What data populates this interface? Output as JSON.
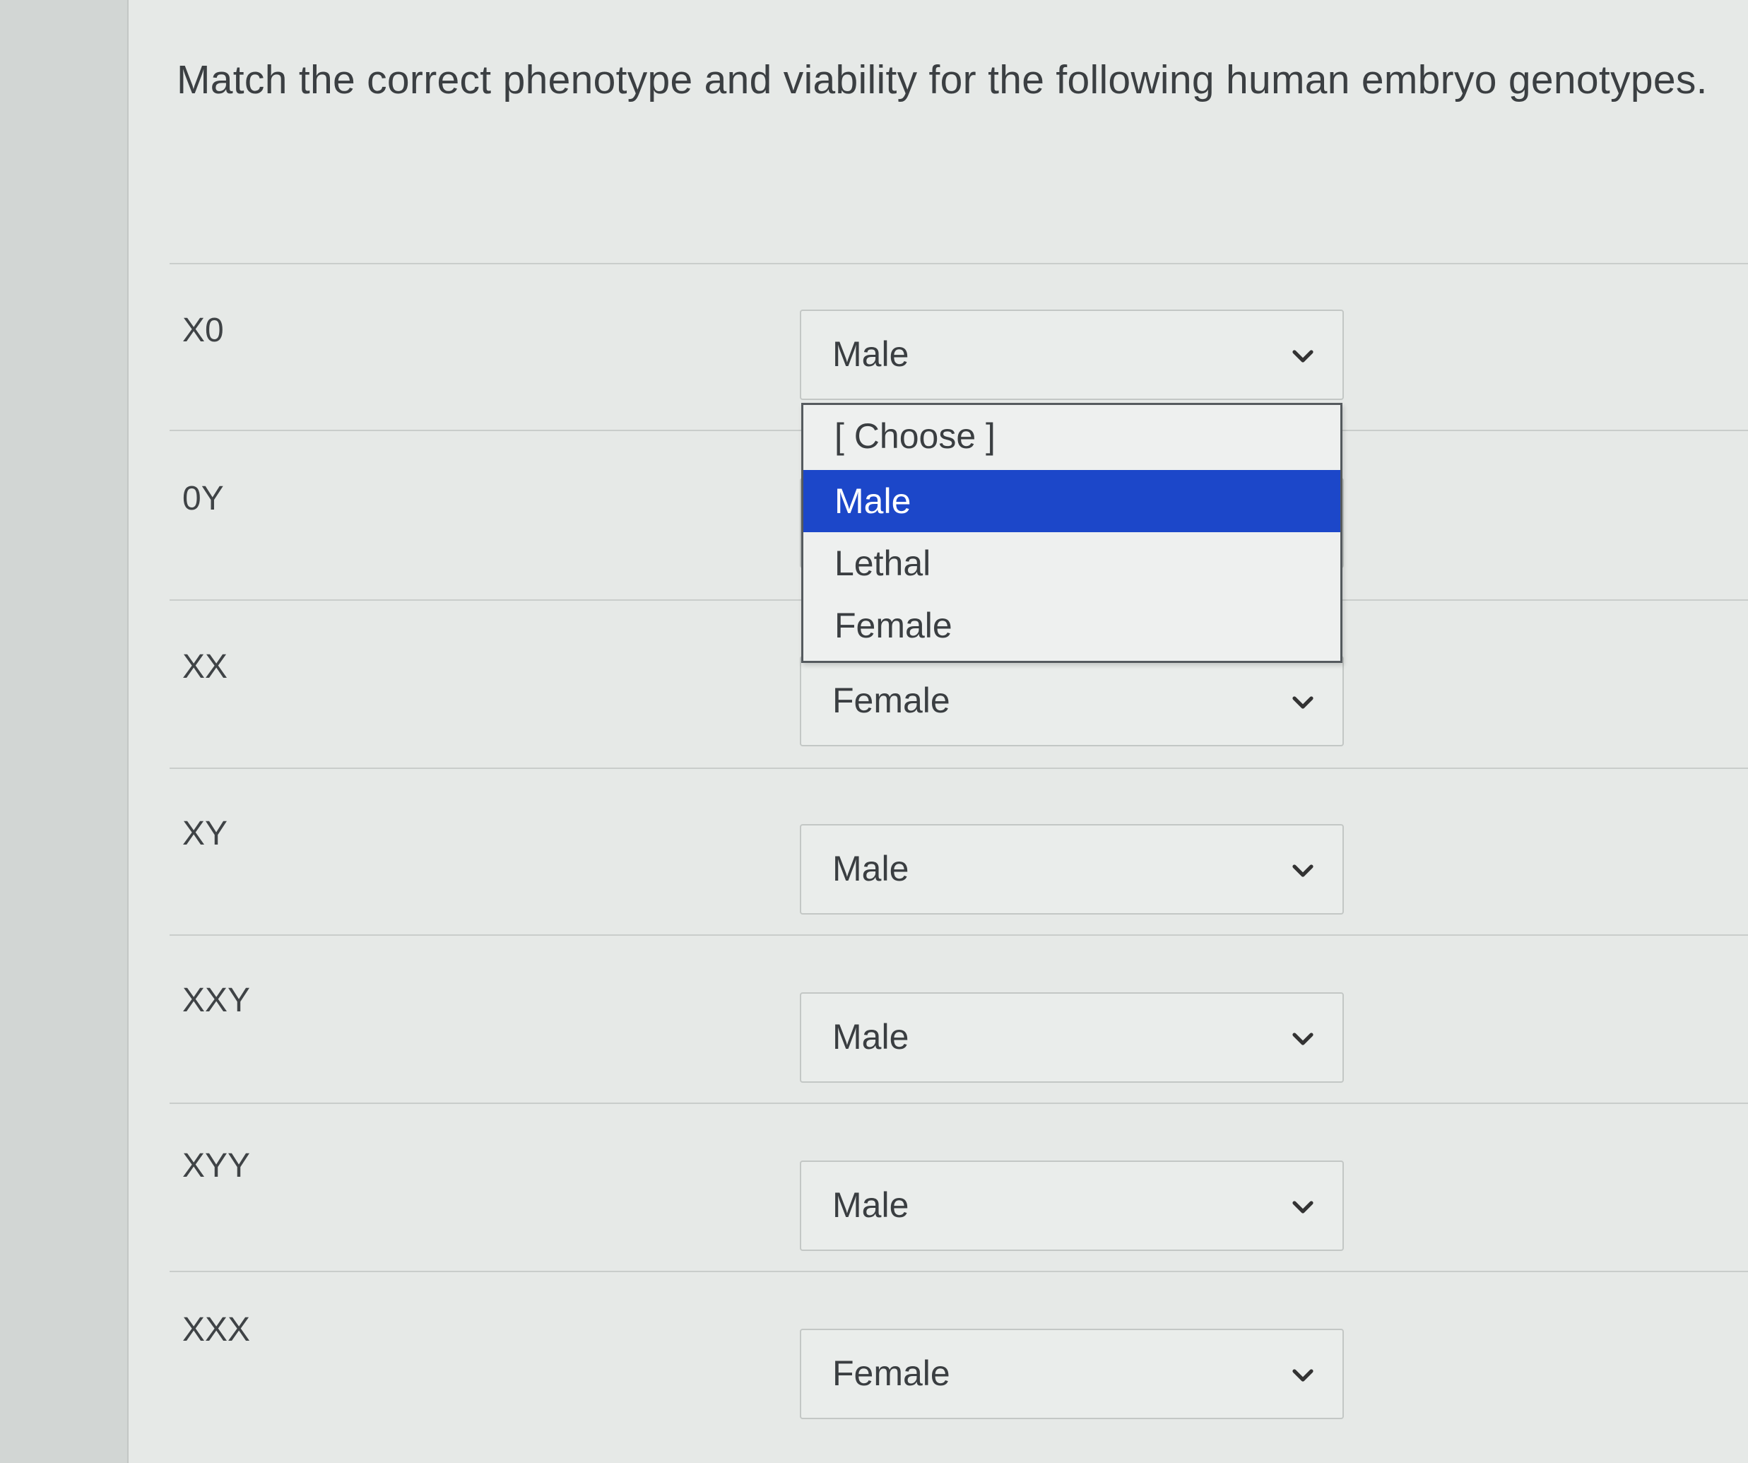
{
  "question": {
    "text": "Match the correct phenotype and viability for the following human embryo genotypes."
  },
  "rows": [
    {
      "genotype": "X0",
      "selected": "Male"
    },
    {
      "genotype": "0Y",
      "selected": ""
    },
    {
      "genotype": "XX",
      "selected": "Female"
    },
    {
      "genotype": "XY",
      "selected": "Male"
    },
    {
      "genotype": "XXY",
      "selected": "Male"
    },
    {
      "genotype": "XYY",
      "selected": "Male"
    },
    {
      "genotype": "XXX",
      "selected": "Female"
    }
  ],
  "dropdown": {
    "open_for": "X0",
    "options": [
      "[ Choose ]",
      "Male",
      "Lethal",
      "Female"
    ],
    "highlighted": "Male"
  },
  "colors": {
    "highlight": "#1c47c9",
    "text": "#3a3e41",
    "background": "#e6e9e7"
  },
  "icons": {
    "select_arrow": "chevron-down-icon"
  }
}
